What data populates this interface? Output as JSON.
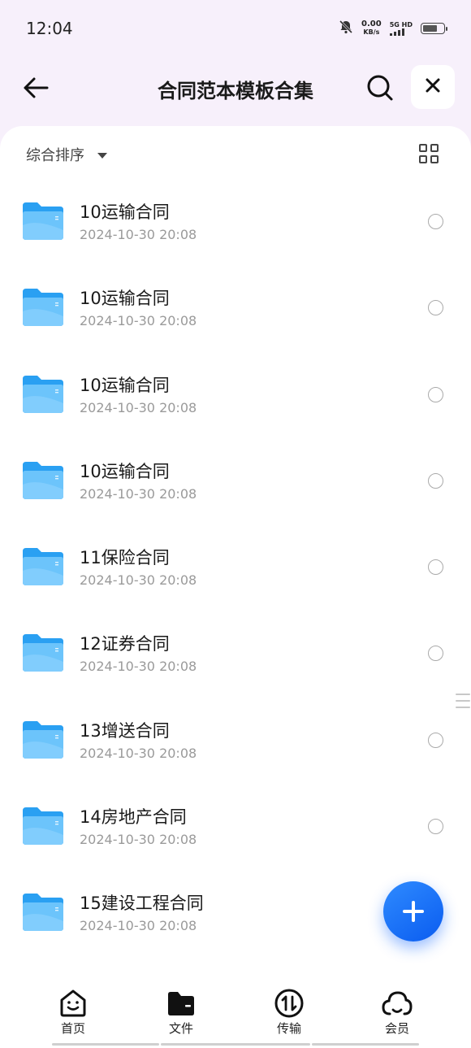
{
  "status_bar": {
    "time": "12:04",
    "speed_value": "0.00",
    "speed_unit": "KB/s",
    "network_top": "5G HD",
    "icons": [
      "bell-muted-icon",
      "signal-icon",
      "battery-icon"
    ]
  },
  "header": {
    "title": "合同范本模板合集",
    "icons": [
      "back-arrow-icon",
      "search-icon",
      "close-icon"
    ]
  },
  "toolbar": {
    "sort_label": "综合排序",
    "view_icon": "grid-view-icon"
  },
  "files": [
    {
      "name": "10运输合同",
      "date": "2024-10-30 20:08"
    },
    {
      "name": "10运输合同",
      "date": "2024-10-30 20:08"
    },
    {
      "name": "10运输合同",
      "date": "2024-10-30 20:08"
    },
    {
      "name": "10运输合同",
      "date": "2024-10-30 20:08"
    },
    {
      "name": "11保险合同",
      "date": "2024-10-30 20:08"
    },
    {
      "name": "12证券合同",
      "date": "2024-10-30 20:08"
    },
    {
      "name": "13增送合同",
      "date": "2024-10-30 20:08"
    },
    {
      "name": "14房地产合同",
      "date": "2024-10-30 20:08"
    },
    {
      "name": "15建设工程合同",
      "date": "2024-10-30 20:08"
    }
  ],
  "bottom_nav": {
    "items": [
      {
        "label": "首页",
        "icon": "home-face-icon"
      },
      {
        "label": "文件",
        "icon": "folder-icon"
      },
      {
        "label": "传输",
        "icon": "transfer-icon"
      },
      {
        "label": "会员",
        "icon": "cloud-icon"
      }
    ]
  },
  "colors": {
    "accent": "#1a6dff",
    "folder": "#35a8f5",
    "header_bg": "#f7f0fb"
  }
}
